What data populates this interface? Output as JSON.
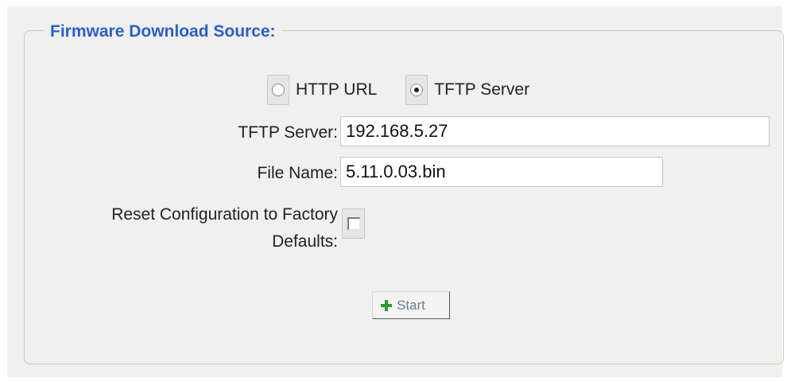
{
  "section": {
    "title": "Firmware Download Source:"
  },
  "source": {
    "options": [
      {
        "label": "HTTP URL",
        "selected": false
      },
      {
        "label": "TFTP Server",
        "selected": true
      }
    ]
  },
  "form": {
    "tftp_server_label": "TFTP Server:",
    "tftp_server_value": "192.168.5.27",
    "file_name_label": "File Name:",
    "file_name_value": "5.11.0.03.bin",
    "reset_label_line1": "Reset Configuration to Factory",
    "reset_label_line2": "Defaults:",
    "reset_checked": false
  },
  "actions": {
    "start_label": "Start"
  },
  "colors": {
    "legend": "#2a5fc7",
    "panel_bg": "#f0f0f0",
    "start_icon": "#2e9a2e"
  }
}
